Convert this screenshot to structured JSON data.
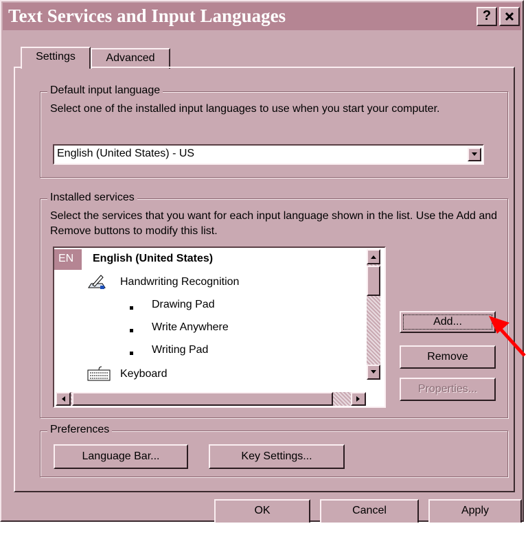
{
  "window": {
    "title": "Text Services and Input Languages",
    "help_label": "?",
    "close_label": "×"
  },
  "tabs": [
    {
      "label": "Settings",
      "active": true
    },
    {
      "label": "Advanced",
      "active": false
    }
  ],
  "default_input": {
    "legend": "Default input language",
    "description": "Select one of the installed input languages to use when you start your computer.",
    "value": "English (United States) - US"
  },
  "installed_services": {
    "legend": "Installed services",
    "description": "Select the services that you want for each input language shown in the list. Use the Add and Remove buttons to modify this list.",
    "language_code": "EN",
    "language_name": "English (United States)",
    "items": [
      {
        "label": "Handwriting Recognition",
        "icon": "pen-tablet-icon"
      },
      {
        "label": "Drawing Pad"
      },
      {
        "label": "Write Anywhere"
      },
      {
        "label": "Writing Pad"
      },
      {
        "label": "Keyboard",
        "icon": "keyboard-icon"
      }
    ],
    "add_label": "Add...",
    "remove_label": "Remove",
    "properties_label": "Properties..."
  },
  "preferences": {
    "legend": "Preferences",
    "language_bar_label": "Language Bar...",
    "key_settings_label": "Key Settings..."
  },
  "footer": {
    "ok_label": "OK",
    "cancel_label": "Cancel",
    "apply_label": "Apply"
  },
  "colors": {
    "dialog_bg": "#c9a9b2",
    "titlebar_bg": "#b58593",
    "arrow": "#ff0000"
  }
}
